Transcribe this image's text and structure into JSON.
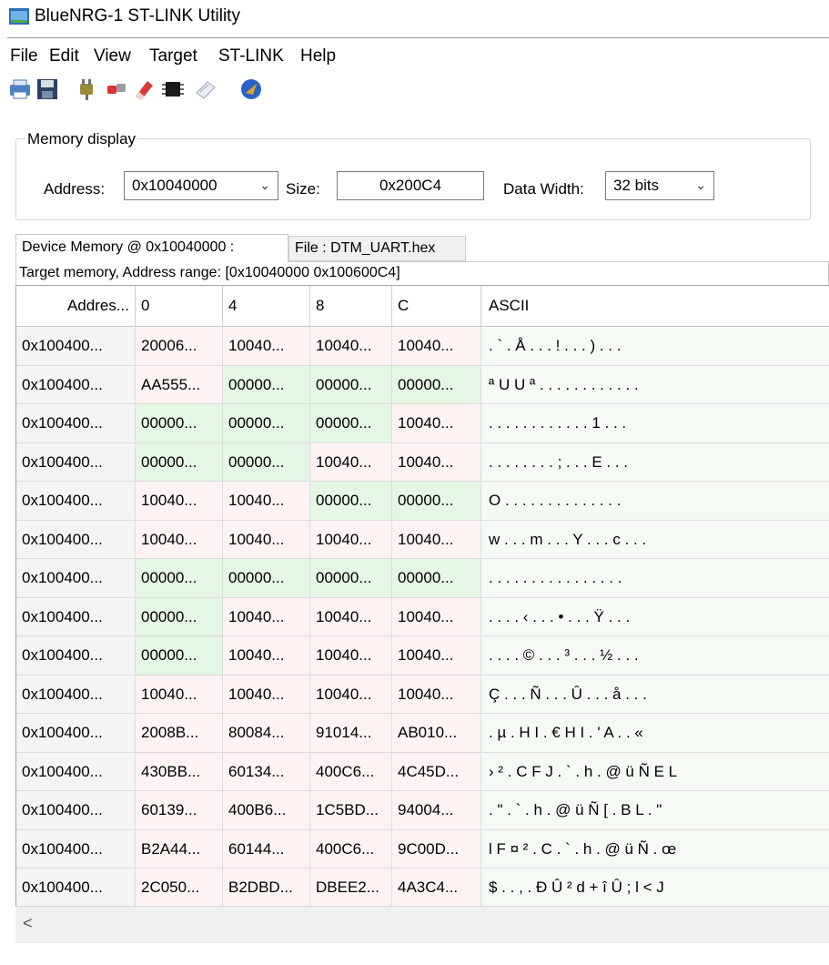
{
  "window": {
    "title": "BlueNRG-1 ST-LINK Utility"
  },
  "menu": [
    "File",
    "Edit",
    "View",
    "Target",
    "ST-LINK",
    "Help"
  ],
  "memory_display": {
    "legend": "Memory display",
    "address_label": "Address:",
    "address_value": "0x10040000",
    "size_label": "Size:",
    "size_value": "0x200C4",
    "data_width_label": "Data Width:",
    "data_width_value": "32 bits"
  },
  "tabs": [
    "Device Memory @ 0x10040000 :",
    "File : DTM_UART.hex"
  ],
  "range_label": "Target memory, Address range: [0x10040000 0x100600C4]",
  "table": {
    "headers": [
      "Addres...",
      "0",
      "4",
      "8",
      "C",
      "ASCII"
    ],
    "rows": [
      [
        "0x100400...",
        "20006...",
        "10040...",
        "10040...",
        "10040...",
        ". ` .  Å . . . ! . . . ) . . ."
      ],
      [
        "0x100400...",
        "AA555...",
        "00000...",
        "00000...",
        "00000...",
        "ª U U ª . . . . . . . . . . . ."
      ],
      [
        "0x100400...",
        "00000...",
        "00000...",
        "00000...",
        "10040...",
        ". . . . . . . . . . . . 1 . . ."
      ],
      [
        "0x100400...",
        "00000...",
        "00000...",
        "10040...",
        "10040...",
        ". . . . . . . . ; . . . E . . ."
      ],
      [
        "0x100400...",
        "10040...",
        "10040...",
        "00000...",
        "00000...",
        "O . . .   . . . . . . . . . . ."
      ],
      [
        "0x100400...",
        "10040...",
        "10040...",
        "10040...",
        "10040...",
        "w . . . m . . . Y . . . c . . ."
      ],
      [
        "0x100400...",
        "00000...",
        "00000...",
        "00000...",
        "00000...",
        ". . . . . . . . . . . . . . . ."
      ],
      [
        "0x100400...",
        "00000...",
        "10040...",
        "10040...",
        "10040...",
        ". . . . ‹ . . . • . . . Ÿ . . ."
      ],
      [
        "0x100400...",
        "00000...",
        "10040...",
        "10040...",
        "10040...",
        ". . . . © . . . ³ . . . ½ . . ."
      ],
      [
        "0x100400...",
        "10040...",
        "10040...",
        "10040...",
        "10040...",
        "Ç . . . Ñ . . . Û . . . å . . ."
      ],
      [
        "0x100400...",
        "2008B...",
        "80084...",
        "91014...",
        "AB010...",
        ". µ .   H I . € H I . ' A . . «"
      ],
      [
        "0x100400...",
        "430BB...",
        "60134...",
        "400C6...",
        "4C45D...",
        "› ² . C F J . ` . h . @ ü Ñ E L"
      ],
      [
        "0x100400...",
        "60139...",
        "400B6...",
        "1C5BD...",
        "94004...",
        ". \" . ` . h . @ ü Ñ [ . B L . \""
      ],
      [
        "0x100400...",
        "B2A44...",
        "60144...",
        "400C6...",
        "9C00D...",
        "l F ¤ ² . C . ` . h . @ ü Ñ . œ"
      ],
      [
        "0x100400...",
        "2C050...",
        "B2DBD...",
        "DBEE2...",
        "4A3C4...",
        "$ . . , . Ð Û ² d + î Û ; l < J"
      ]
    ],
    "highlighted": [
      [
        false,
        false,
        false,
        false
      ],
      [
        false,
        true,
        true,
        true
      ],
      [
        true,
        true,
        true,
        false
      ],
      [
        true,
        true,
        false,
        false
      ],
      [
        false,
        false,
        true,
        true
      ],
      [
        false,
        false,
        false,
        false
      ],
      [
        true,
        true,
        true,
        true
      ],
      [
        true,
        false,
        false,
        false
      ],
      [
        true,
        false,
        false,
        false
      ],
      [
        false,
        false,
        false,
        false
      ],
      [
        false,
        false,
        false,
        false
      ],
      [
        false,
        false,
        false,
        false
      ],
      [
        false,
        false,
        false,
        false
      ],
      [
        false,
        false,
        false,
        false
      ],
      [
        false,
        false,
        false,
        false
      ]
    ]
  },
  "toolbar_icons": [
    "printer-icon",
    "save-icon",
    "connect-icon",
    "disconnect-icon",
    "erase-icon",
    "chip-icon",
    "checksum-icon",
    "program-icon"
  ],
  "scroll": {
    "left_arrow": "<"
  },
  "colors": {
    "cell_default": "#fdf3f3",
    "cell_highlight": "#e4f6e4",
    "ascii_bg": "#f5fbf4",
    "address_bg": "#f4f4f4"
  }
}
